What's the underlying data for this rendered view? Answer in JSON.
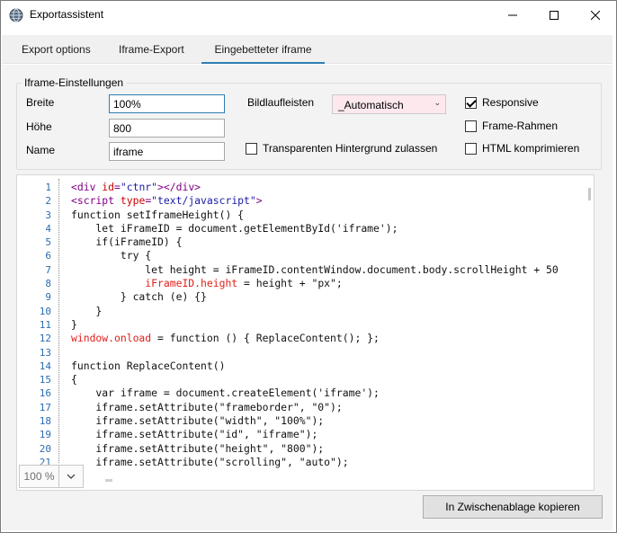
{
  "window": {
    "title": "Exportassistent",
    "icon": "app-globe-icon",
    "controls": [
      "minimize-icon",
      "maximize-icon",
      "close-icon"
    ]
  },
  "tabs": [
    {
      "label": "Export options",
      "active": false
    },
    {
      "label": "Iframe-Export",
      "active": false
    },
    {
      "label": "Eingebetteter iframe",
      "active": true
    }
  ],
  "settings": {
    "group_title": "Iframe-Einstellungen",
    "width_label": "Breite",
    "width_value": "100%",
    "height_label": "Höhe",
    "height_value": "800",
    "name_label": "Name",
    "name_value": "iframe",
    "scrollbars_label": "Bildlaufleisten",
    "scrollbars_value": "_Automatisch",
    "transparent_label": "Transparenten Hintergrund zulassen",
    "transparent_checked": false,
    "responsive_label": "Responsive",
    "responsive_checked": true,
    "frame_border_label": "Frame-Rahmen",
    "frame_border_checked": false,
    "compress_label": "HTML komprimieren",
    "compress_checked": false
  },
  "editor": {
    "line_numbers": [
      "1",
      "2",
      "3",
      "4",
      "5",
      "6",
      "7",
      "8",
      "9",
      "10",
      "11",
      "12",
      "13",
      "14",
      "15",
      "16",
      "17",
      "18",
      "19",
      "20",
      "21"
    ],
    "zoom": "100 %"
  },
  "colors": {
    "accent": "#2d7db3",
    "line_number": "#2b6cb0",
    "tag": "#800080",
    "attribute": "#cc0000",
    "string": "#1a1aa6",
    "highlight": "#e0201b",
    "combo_background": "#fde8ee"
  },
  "actions": {
    "copy_label": "In Zwischenablage kopieren"
  }
}
